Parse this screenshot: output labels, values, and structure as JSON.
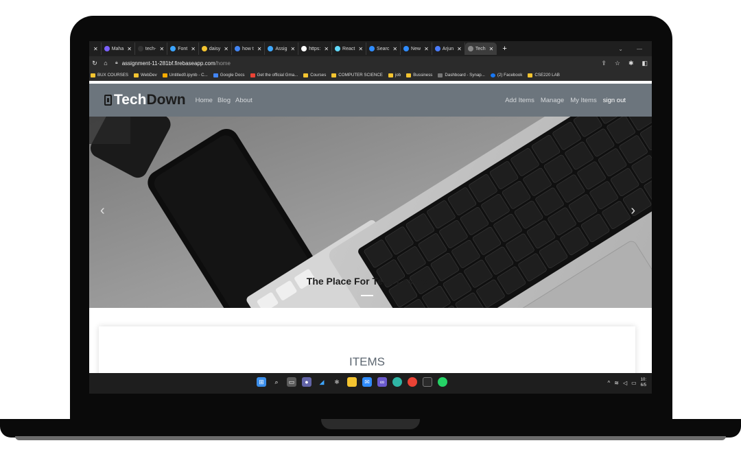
{
  "browser": {
    "tabs": [
      {
        "label": "Maha",
        "color": "#7b61ff"
      },
      {
        "label": "tech-",
        "color": "#333333"
      },
      {
        "label": "Font",
        "color": "#3ba4ff"
      },
      {
        "label": "daisy",
        "color": "#f4c430"
      },
      {
        "label": "how t",
        "color": "#4285f4"
      },
      {
        "label": "Assig",
        "color": "#3ea8ff"
      },
      {
        "label": "https:",
        "color": "#ffffff"
      },
      {
        "label": "React",
        "color": "#61dafb"
      },
      {
        "label": "Searc",
        "color": "#2f8cff"
      },
      {
        "label": "New",
        "color": "#2f8cff"
      },
      {
        "label": "Arjun",
        "color": "#4a7cff"
      },
      {
        "label": "Tech",
        "color": "#888888"
      }
    ],
    "url_host": "assignment-11-281bf.firebaseapp.com",
    "url_path": "/home",
    "bookmarks": [
      {
        "label": "BUX COURSES",
        "icon": "folder"
      },
      {
        "label": "WebDev",
        "icon": "folder"
      },
      {
        "label": "Untitled0.ipynb - C...",
        "icon": "colab"
      },
      {
        "label": "Google Docs",
        "icon": "docs"
      },
      {
        "label": "Get the official Gma...",
        "icon": "gmail"
      },
      {
        "label": "Courses",
        "icon": "folder"
      },
      {
        "label": "COMPUTER SCIENCE",
        "icon": "folder"
      },
      {
        "label": "job",
        "icon": "folder"
      },
      {
        "label": "Bussiness",
        "icon": "folder"
      },
      {
        "label": "Dashboard - Synap...",
        "icon": "page"
      },
      {
        "label": "(2) Facebook",
        "icon": "facebook"
      },
      {
        "label": "CSE220 LAB",
        "icon": "folder"
      }
    ]
  },
  "site": {
    "brand_tech": "Tech",
    "brand_down": "Down",
    "nav_left": [
      "Home",
      "Blog",
      "About"
    ],
    "nav_right": [
      "Add Items",
      "Manage",
      "My Items"
    ],
    "signout": "sign out",
    "hero_caption": "The Place For Tech Lovers!!",
    "items_title": "ITEMS"
  },
  "taskbar": {
    "clock_time": "10:",
    "clock_date": "6/5"
  },
  "colors": {
    "navbar": "#6c757d",
    "tab_bg": "#1f1f1f"
  }
}
